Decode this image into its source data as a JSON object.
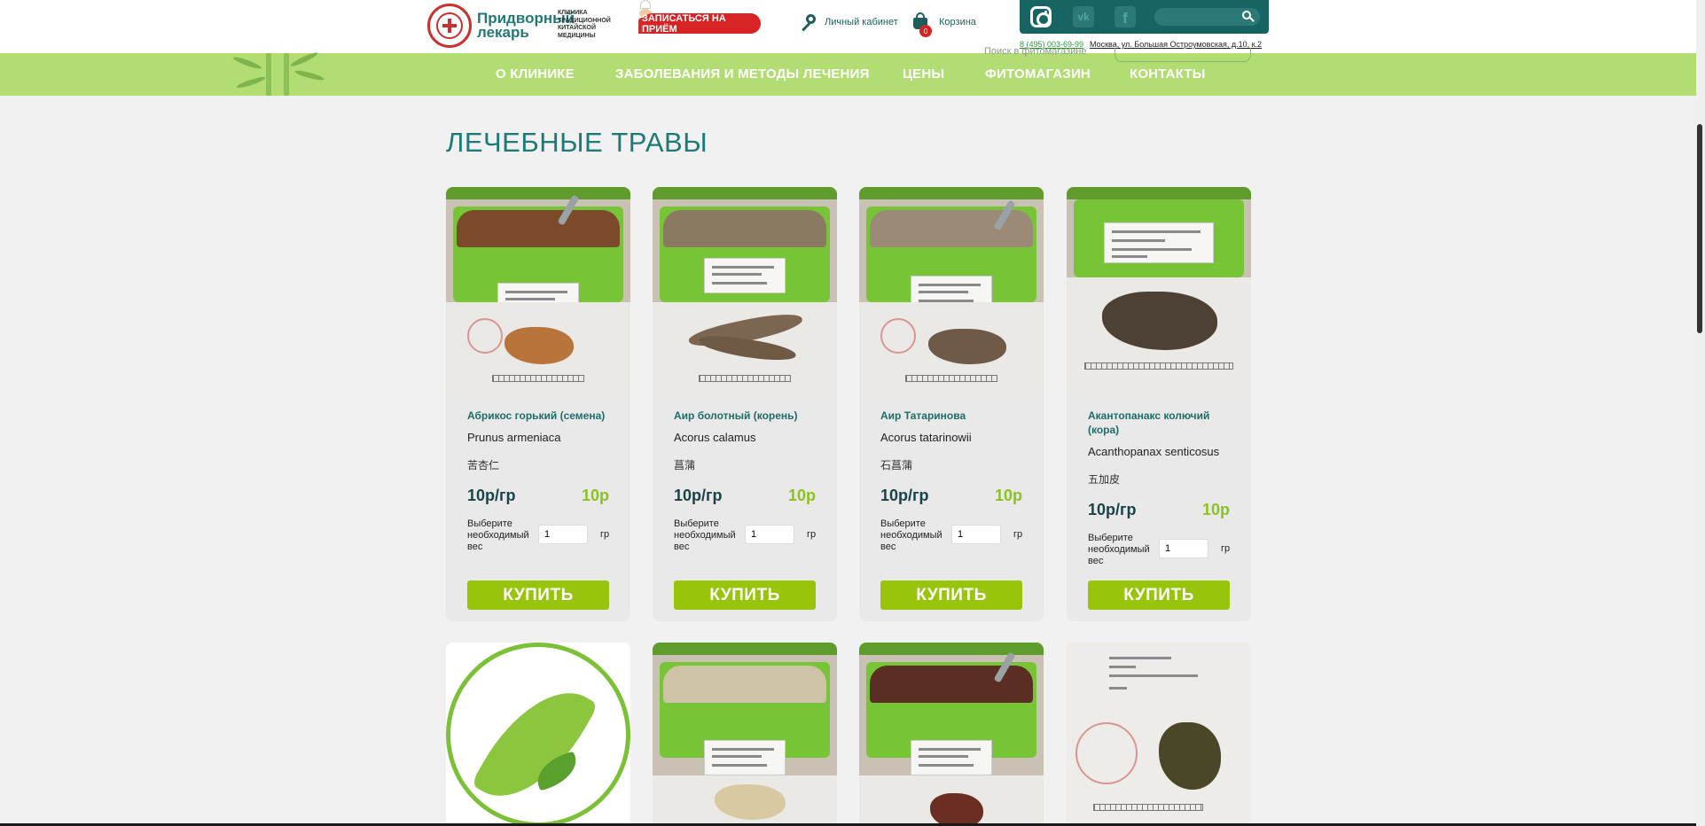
{
  "header": {
    "brand_name": "Придворный лекарь",
    "brand_subtitle": "КЛИНИКА ТРАДИЦИОННОЙ КИТАЙСКОЙ МЕДИЦИНЫ",
    "appointment_button": "ЗАПИСАТЬСЯ НА ПРИЁМ",
    "cabinet_link": "Личный кабинет",
    "cart_link": "Корзина",
    "cart_count": "0",
    "phone": "8 (495) 003-69-99",
    "address": "Москва, ул. Большая Остроумовская, д.10, к.2",
    "search_placeholder": "",
    "ghost_search_label": "Поиск в фитомагазине",
    "social_icons": [
      "instagram-icon",
      "vk-icon",
      "facebook-icon"
    ]
  },
  "nav": {
    "items": [
      "О КЛИНИКЕ",
      "ЗАБОЛЕВАНИЯ И МЕТОДЫ ЛЕЧЕНИЯ",
      "ЦЕНЫ",
      "ФИТОМАГАЗИН",
      "КОНТАКТЫ"
    ]
  },
  "page": {
    "title": "ЛЕЧЕБНЫЕ ТРАВЫ"
  },
  "products": [
    {
      "name": "Абрикос горький (семена)",
      "latin": "Prunus armeniaca",
      "chinese": "苦杏仁",
      "price_per_gram": "10р/гр",
      "price_total": "10р",
      "weight_label": "Выберите необходимый вес",
      "weight_value": "1",
      "weight_unit": "гр",
      "buy_label": "КУПИТЬ"
    },
    {
      "name": "Аир болотный (корень)",
      "latin": "Acorus calamus",
      "chinese": "菖蒲",
      "price_per_gram": "10р/гр",
      "price_total": "10р",
      "weight_label": "Выберите необходимый вес",
      "weight_value": "1",
      "weight_unit": "гр",
      "buy_label": "КУПИТЬ"
    },
    {
      "name": "Аир Татаринова",
      "latin": "Acorus tatarinowii",
      "chinese": "石菖蒲",
      "price_per_gram": "10р/гр",
      "price_total": "10р",
      "weight_label": "Выберите необходимый вес",
      "weight_value": "1",
      "weight_unit": "гр",
      "buy_label": "КУПИТЬ"
    },
    {
      "name": "Акантопанакс колючий (кора)",
      "latin": "Acanthopanax senticosus",
      "chinese": "五加皮",
      "price_per_gram": "10р/гр",
      "price_total": "10р",
      "weight_label": "Выберите необходимый вес",
      "weight_value": "1",
      "weight_unit": "гр",
      "buy_label": "КУПИТЬ"
    }
  ],
  "colors": {
    "accent_green": "#b2dd72",
    "brand_teal": "#1e7a76",
    "buy_button": "#99c40c",
    "appointment_red": "#d72323"
  }
}
